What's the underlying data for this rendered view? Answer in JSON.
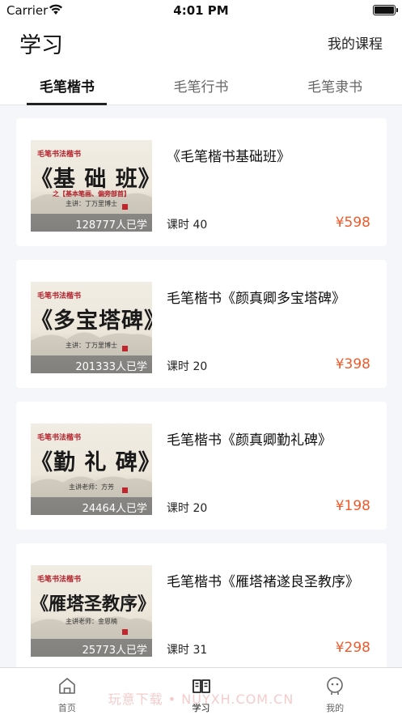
{
  "status_bar": {
    "carrier": "Carrier",
    "time": "4:01 PM"
  },
  "header": {
    "title": "学习",
    "my_courses": "我的课程"
  },
  "tabs": [
    {
      "label": "毛笔楷书"
    },
    {
      "label": "毛笔行书"
    },
    {
      "label": "毛笔隶书"
    }
  ],
  "courses": [
    {
      "title": "《毛笔楷书基础班》",
      "lessons": "课时 40",
      "price": "¥598",
      "thumb": {
        "series": "毛笔书法楷书",
        "name": "《基 础 班》",
        "subtitle": "之【基本笔画、偏旁部首】",
        "teacher": "主讲：丁万里博士",
        "enrolled": "128777人已学"
      }
    },
    {
      "title": "毛笔楷书《颜真卿多宝塔碑》",
      "lessons": "课时 20",
      "price": "¥398",
      "thumb": {
        "series": "毛笔书法楷书",
        "name": "《多宝塔碑》",
        "subtitle": "",
        "teacher": "主讲：丁万里博士",
        "enrolled": "201333人已学"
      }
    },
    {
      "title": "毛笔楷书《颜真卿勤礼碑》",
      "lessons": "课时 20",
      "price": "¥198",
      "thumb": {
        "series": "毛笔书法楷书",
        "name": "《勤 礼 碑》",
        "subtitle": "",
        "teacher": "主讲老师：方芳",
        "enrolled": "24464人已学"
      }
    },
    {
      "title": "毛笔楷书《雁塔褚遂良圣教序》",
      "lessons": "课时 31",
      "price": "¥298",
      "thumb": {
        "series": "毛笔书法楷书",
        "name": "《雁塔圣教序》",
        "subtitle": "",
        "teacher": "主讲老师：金恩楠",
        "enrolled": "25773人已学"
      }
    }
  ],
  "tabbar": [
    {
      "label": "首页",
      "icon": "home-icon"
    },
    {
      "label": "学习",
      "icon": "book-icon"
    },
    {
      "label": "我的",
      "icon": "profile-icon"
    }
  ],
  "watermark": "玩意下载 • NUYXH.COM.CN",
  "colors": {
    "price": "#f15a2b",
    "accent_red": "#b3202a",
    "active_text": "#111111"
  }
}
